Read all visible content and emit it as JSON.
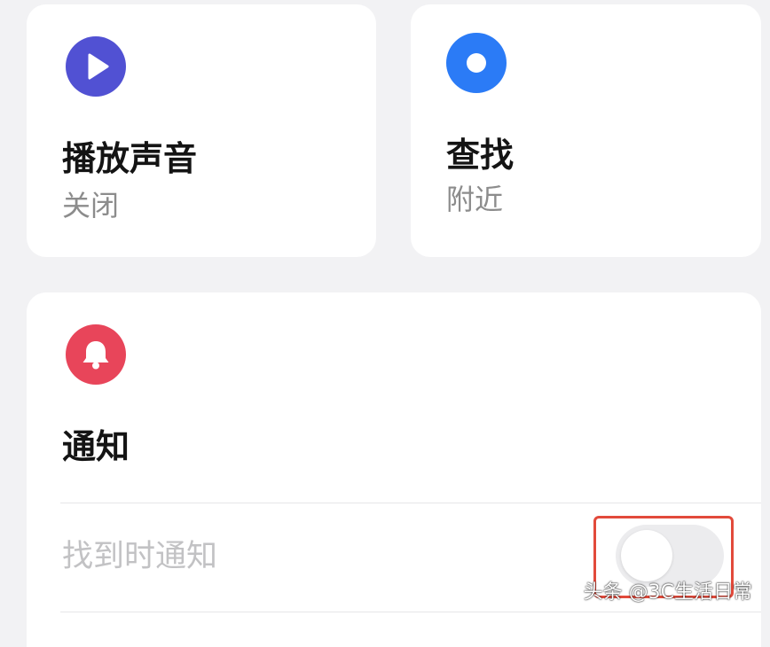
{
  "cards": {
    "play_sound": {
      "title": "播放声音",
      "status": "关闭",
      "icon": "play-icon",
      "icon_color": "#5151d3"
    },
    "find": {
      "title": "查找",
      "status": "附近",
      "icon": "location-dot-icon",
      "icon_color": "#2b7bf6"
    },
    "notifications": {
      "title": "通知",
      "icon": "bell-icon",
      "icon_color": "#e8455a",
      "rows": [
        {
          "label": "找到时通知",
          "toggle_on": false
        }
      ]
    }
  },
  "highlight_color": "#e24a3b",
  "watermark": "头条 @3C生活日常"
}
